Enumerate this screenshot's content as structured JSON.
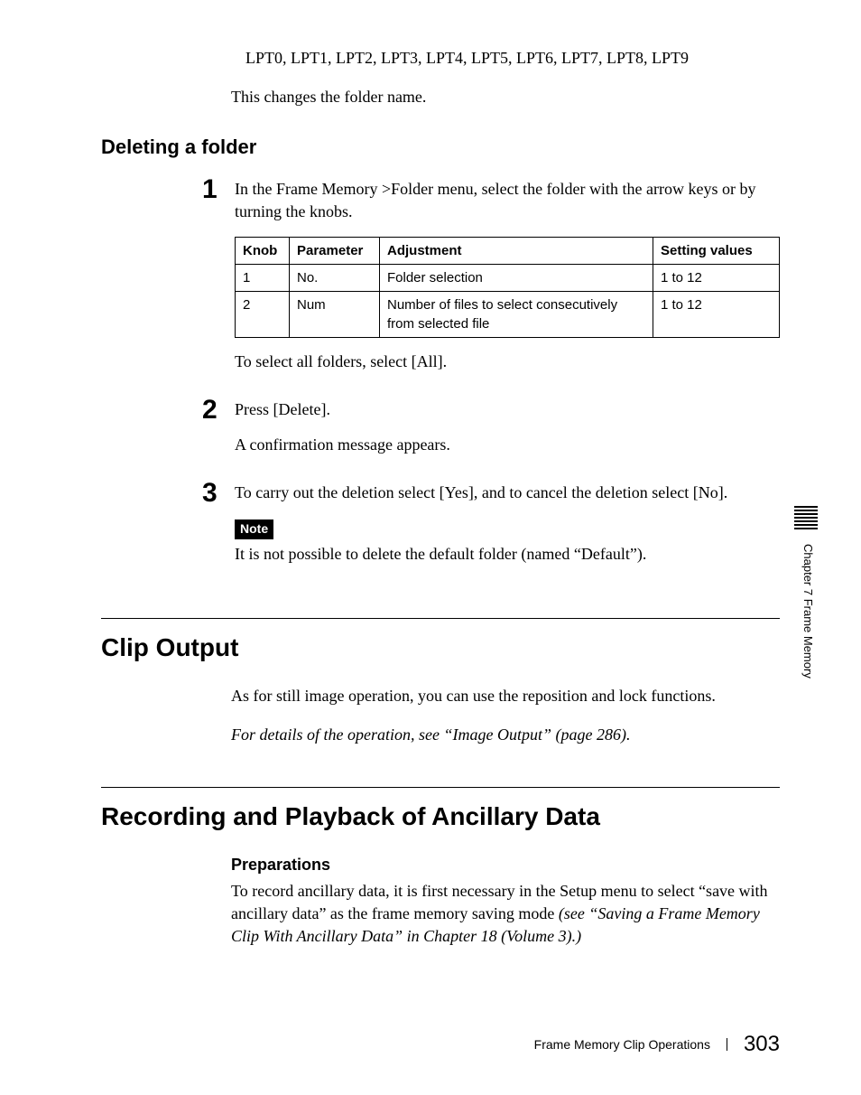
{
  "top_list": "LPT0, LPT1, LPT2, LPT3, LPT4, LPT5, LPT6, LPT7, LPT8, LPT9",
  "top_result": "This changes the folder name.",
  "delete_heading": "Deleting a folder",
  "step1_text": "In the Frame Memory >Folder menu, select the folder with the arrow keys or by turning the knobs.",
  "table": {
    "headers": {
      "knob": "Knob",
      "param": "Parameter",
      "adj": "Adjustment",
      "setting": "Setting values"
    },
    "rows": [
      {
        "knob": "1",
        "param": "No.",
        "adj": "Folder selection",
        "setting": "1 to 12"
      },
      {
        "knob": "2",
        "param": "Num",
        "adj": "Number of files to select consecutively from selected file",
        "setting": "1 to 12"
      }
    ]
  },
  "step1_after": "To select all folders, select [All].",
  "step2_text": "Press [Delete].",
  "step2_after": "A confirmation message appears.",
  "step3_text": "To carry out the deletion select [Yes], and to cancel the deletion select [No].",
  "note_label": "Note",
  "note_text": "It is not possible to delete the default folder (named “Default”).",
  "clip_heading": "Clip Output",
  "clip_text": "As for still image operation, you can use the reposition and lock functions.",
  "clip_ref": "For details of the operation, see “Image Output” (page 286).",
  "rec_heading": "Recording and Playback of Ancillary Data",
  "prep_heading": "Preparations",
  "prep_text_a": "To record ancillary data, it is first necessary in the Setup menu to select “save with ancillary data” as the frame memory saving mode ",
  "prep_text_b": "(see “Saving a Frame Memory Clip With Ancillary Data” in Chapter 18 (Volume 3).)",
  "side_label": "Chapter 7  Frame Memory",
  "footer_title": "Frame Memory Clip Operations",
  "footer_page": "303",
  "nums": {
    "one": "1",
    "two": "2",
    "three": "3"
  }
}
